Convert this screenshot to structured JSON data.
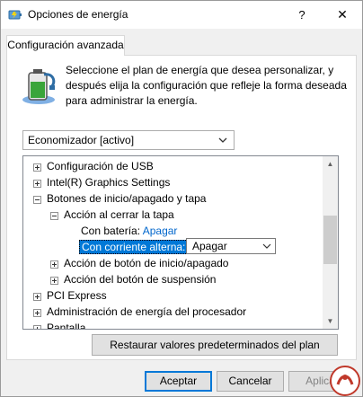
{
  "window": {
    "title": "Opciones de energía",
    "help_glyph": "?",
    "close_glyph": "✕"
  },
  "tab": {
    "label": "Configuración avanzada"
  },
  "description": "Seleccione el plan de energía que desea personalizar, y después elija la configuración que refleje la forma deseada para administrar la energía.",
  "plan_select": {
    "value": "Economizador [activo]"
  },
  "tree": {
    "items": [
      {
        "label": "Configuración de USB"
      },
      {
        "label": "Intel(R) Graphics Settings"
      },
      {
        "label": "Botones de inicio/apagado y tapa"
      },
      {
        "label": "Acción al cerrar la tapa"
      },
      {
        "label": "Con batería:",
        "value": "Apagar"
      },
      {
        "label": "Con corriente alterna:",
        "value": "Apagar"
      },
      {
        "label": "Acción de botón de inicio/apagado"
      },
      {
        "label": "Acción del botón de suspensión"
      },
      {
        "label": "PCI Express"
      },
      {
        "label": "Administración de energía del procesador"
      },
      {
        "label": "Pantalla"
      }
    ]
  },
  "restore_button": {
    "label": "Restaurar valores predeterminados del plan"
  },
  "footer": {
    "accept": "Aceptar",
    "cancel": "Cancelar",
    "apply": "Aplicar"
  },
  "colors": {
    "accent": "#0078d7",
    "link": "#0066cc",
    "battery_green": "#3aa53a"
  },
  "icons": [
    "power-options-icon",
    "battery-plan-icon",
    "help-icon",
    "close-icon",
    "chevron-down-icon",
    "expand-icon",
    "collapse-icon",
    "scroll-up-icon",
    "scroll-down-icon",
    "watermark-logo-icon"
  ]
}
